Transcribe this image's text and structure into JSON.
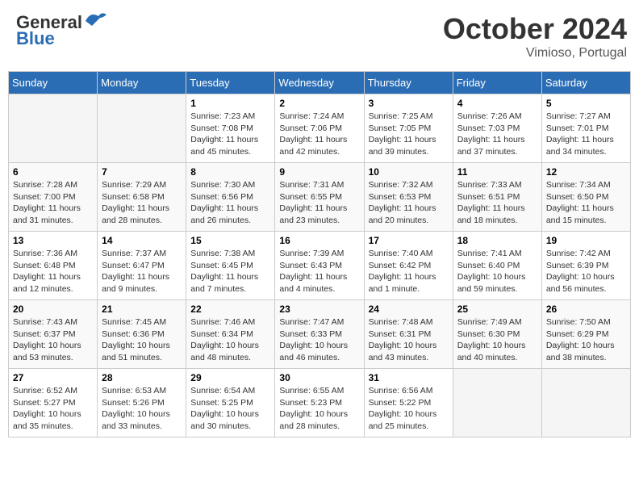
{
  "header": {
    "title": "October 2024",
    "location": "Vimioso, Portugal",
    "logo_general": "General",
    "logo_blue": "Blue"
  },
  "days_of_week": [
    "Sunday",
    "Monday",
    "Tuesday",
    "Wednesday",
    "Thursday",
    "Friday",
    "Saturday"
  ],
  "weeks": [
    [
      {
        "day": "",
        "sunrise": "",
        "sunset": "",
        "daylight": "",
        "empty": true
      },
      {
        "day": "",
        "sunrise": "",
        "sunset": "",
        "daylight": "",
        "empty": true
      },
      {
        "day": "1",
        "sunrise": "Sunrise: 7:23 AM",
        "sunset": "Sunset: 7:08 PM",
        "daylight": "Daylight: 11 hours and 45 minutes."
      },
      {
        "day": "2",
        "sunrise": "Sunrise: 7:24 AM",
        "sunset": "Sunset: 7:06 PM",
        "daylight": "Daylight: 11 hours and 42 minutes."
      },
      {
        "day": "3",
        "sunrise": "Sunrise: 7:25 AM",
        "sunset": "Sunset: 7:05 PM",
        "daylight": "Daylight: 11 hours and 39 minutes."
      },
      {
        "day": "4",
        "sunrise": "Sunrise: 7:26 AM",
        "sunset": "Sunset: 7:03 PM",
        "daylight": "Daylight: 11 hours and 37 minutes."
      },
      {
        "day": "5",
        "sunrise": "Sunrise: 7:27 AM",
        "sunset": "Sunset: 7:01 PM",
        "daylight": "Daylight: 11 hours and 34 minutes."
      }
    ],
    [
      {
        "day": "6",
        "sunrise": "Sunrise: 7:28 AM",
        "sunset": "Sunset: 7:00 PM",
        "daylight": "Daylight: 11 hours and 31 minutes."
      },
      {
        "day": "7",
        "sunrise": "Sunrise: 7:29 AM",
        "sunset": "Sunset: 6:58 PM",
        "daylight": "Daylight: 11 hours and 28 minutes."
      },
      {
        "day": "8",
        "sunrise": "Sunrise: 7:30 AM",
        "sunset": "Sunset: 6:56 PM",
        "daylight": "Daylight: 11 hours and 26 minutes."
      },
      {
        "day": "9",
        "sunrise": "Sunrise: 7:31 AM",
        "sunset": "Sunset: 6:55 PM",
        "daylight": "Daylight: 11 hours and 23 minutes."
      },
      {
        "day": "10",
        "sunrise": "Sunrise: 7:32 AM",
        "sunset": "Sunset: 6:53 PM",
        "daylight": "Daylight: 11 hours and 20 minutes."
      },
      {
        "day": "11",
        "sunrise": "Sunrise: 7:33 AM",
        "sunset": "Sunset: 6:51 PM",
        "daylight": "Daylight: 11 hours and 18 minutes."
      },
      {
        "day": "12",
        "sunrise": "Sunrise: 7:34 AM",
        "sunset": "Sunset: 6:50 PM",
        "daylight": "Daylight: 11 hours and 15 minutes."
      }
    ],
    [
      {
        "day": "13",
        "sunrise": "Sunrise: 7:36 AM",
        "sunset": "Sunset: 6:48 PM",
        "daylight": "Daylight: 11 hours and 12 minutes."
      },
      {
        "day": "14",
        "sunrise": "Sunrise: 7:37 AM",
        "sunset": "Sunset: 6:47 PM",
        "daylight": "Daylight: 11 hours and 9 minutes."
      },
      {
        "day": "15",
        "sunrise": "Sunrise: 7:38 AM",
        "sunset": "Sunset: 6:45 PM",
        "daylight": "Daylight: 11 hours and 7 minutes."
      },
      {
        "day": "16",
        "sunrise": "Sunrise: 7:39 AM",
        "sunset": "Sunset: 6:43 PM",
        "daylight": "Daylight: 11 hours and 4 minutes."
      },
      {
        "day": "17",
        "sunrise": "Sunrise: 7:40 AM",
        "sunset": "Sunset: 6:42 PM",
        "daylight": "Daylight: 11 hours and 1 minute."
      },
      {
        "day": "18",
        "sunrise": "Sunrise: 7:41 AM",
        "sunset": "Sunset: 6:40 PM",
        "daylight": "Daylight: 10 hours and 59 minutes."
      },
      {
        "day": "19",
        "sunrise": "Sunrise: 7:42 AM",
        "sunset": "Sunset: 6:39 PM",
        "daylight": "Daylight: 10 hours and 56 minutes."
      }
    ],
    [
      {
        "day": "20",
        "sunrise": "Sunrise: 7:43 AM",
        "sunset": "Sunset: 6:37 PM",
        "daylight": "Daylight: 10 hours and 53 minutes."
      },
      {
        "day": "21",
        "sunrise": "Sunrise: 7:45 AM",
        "sunset": "Sunset: 6:36 PM",
        "daylight": "Daylight: 10 hours and 51 minutes."
      },
      {
        "day": "22",
        "sunrise": "Sunrise: 7:46 AM",
        "sunset": "Sunset: 6:34 PM",
        "daylight": "Daylight: 10 hours and 48 minutes."
      },
      {
        "day": "23",
        "sunrise": "Sunrise: 7:47 AM",
        "sunset": "Sunset: 6:33 PM",
        "daylight": "Daylight: 10 hours and 46 minutes."
      },
      {
        "day": "24",
        "sunrise": "Sunrise: 7:48 AM",
        "sunset": "Sunset: 6:31 PM",
        "daylight": "Daylight: 10 hours and 43 minutes."
      },
      {
        "day": "25",
        "sunrise": "Sunrise: 7:49 AM",
        "sunset": "Sunset: 6:30 PM",
        "daylight": "Daylight: 10 hours and 40 minutes."
      },
      {
        "day": "26",
        "sunrise": "Sunrise: 7:50 AM",
        "sunset": "Sunset: 6:29 PM",
        "daylight": "Daylight: 10 hours and 38 minutes."
      }
    ],
    [
      {
        "day": "27",
        "sunrise": "Sunrise: 6:52 AM",
        "sunset": "Sunset: 5:27 PM",
        "daylight": "Daylight: 10 hours and 35 minutes."
      },
      {
        "day": "28",
        "sunrise": "Sunrise: 6:53 AM",
        "sunset": "Sunset: 5:26 PM",
        "daylight": "Daylight: 10 hours and 33 minutes."
      },
      {
        "day": "29",
        "sunrise": "Sunrise: 6:54 AM",
        "sunset": "Sunset: 5:25 PM",
        "daylight": "Daylight: 10 hours and 30 minutes."
      },
      {
        "day": "30",
        "sunrise": "Sunrise: 6:55 AM",
        "sunset": "Sunset: 5:23 PM",
        "daylight": "Daylight: 10 hours and 28 minutes."
      },
      {
        "day": "31",
        "sunrise": "Sunrise: 6:56 AM",
        "sunset": "Sunset: 5:22 PM",
        "daylight": "Daylight: 10 hours and 25 minutes."
      },
      {
        "day": "",
        "sunrise": "",
        "sunset": "",
        "daylight": "",
        "empty": true
      },
      {
        "day": "",
        "sunrise": "",
        "sunset": "",
        "daylight": "",
        "empty": true
      }
    ]
  ]
}
